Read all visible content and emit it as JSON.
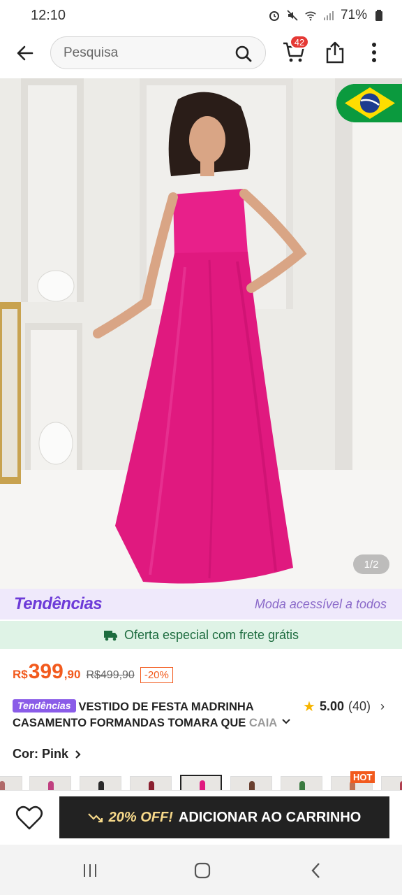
{
  "status_bar": {
    "time": "12:10",
    "battery": "71%"
  },
  "search": {
    "placeholder": "Pesquisa"
  },
  "cart": {
    "badge_count": "42"
  },
  "gallery": {
    "counter": "1/2",
    "flag": "brazil-flag"
  },
  "trends": {
    "logo": "Tendências",
    "tagline": "Moda acessível a todos"
  },
  "shipping": {
    "text": "Oferta especial com frete grátis"
  },
  "price": {
    "currency": "R$",
    "main": "399",
    "cents": ",90",
    "old": "R$499,90",
    "discount": "-20%"
  },
  "title": {
    "tag": "Tendências",
    "text": "VESTIDO DE FESTA MADRINHA CASAMENTO FORMANDAS TOMARA QUE ",
    "faded": "CAIA"
  },
  "rating": {
    "score": "5.00",
    "count": "(40)"
  },
  "color": {
    "label": "Cor: Pink"
  },
  "thumbnails": {
    "hot_label": "HOT"
  },
  "action": {
    "promo": "20% OFF!",
    "label": "ADICIONAR AO CARRINHO"
  },
  "colors": {
    "accent": "#f25a1d",
    "trends_purple": "#6d3bd8",
    "dress_pink": "#e8208a"
  }
}
